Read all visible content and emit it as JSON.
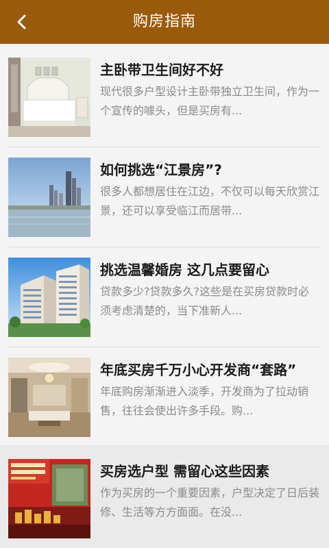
{
  "header": {
    "title": "购房指南"
  },
  "articles": [
    {
      "title": "主卧带卫生间好不好",
      "desc": "现代很多户型设计主卧带独立卫生间，作为一个宣传的噱头，但是买房有..."
    },
    {
      "title": "如何挑选“江景房”?",
      "desc": "很多人都想居住在江边，不仅可以每天欣赏江景，还可以享受临江而居带..."
    },
    {
      "title": "挑选温馨婚房 这几点要留心",
      "desc": "贷款多少?贷款多久?这些是在买房贷款时必须考虑清楚的，当下准新人..."
    },
    {
      "title": "年底买房千万小心开发商“套路”",
      "desc": "年底购房渐渐进入淡季，开发商为了拉动销售，往往会使出许多手段。购..."
    },
    {
      "title": "买房选户型 需留心这些因素",
      "desc": "作为买房的一个重要因素，户型决定了日后装修、生活等方方面面。在没..."
    }
  ],
  "colors": {
    "header_bg": "#9a5a0c",
    "title_text": "#1a1a1a",
    "desc_text": "#8a8a8a"
  },
  "icons": {
    "back": "chevron-left-icon"
  }
}
